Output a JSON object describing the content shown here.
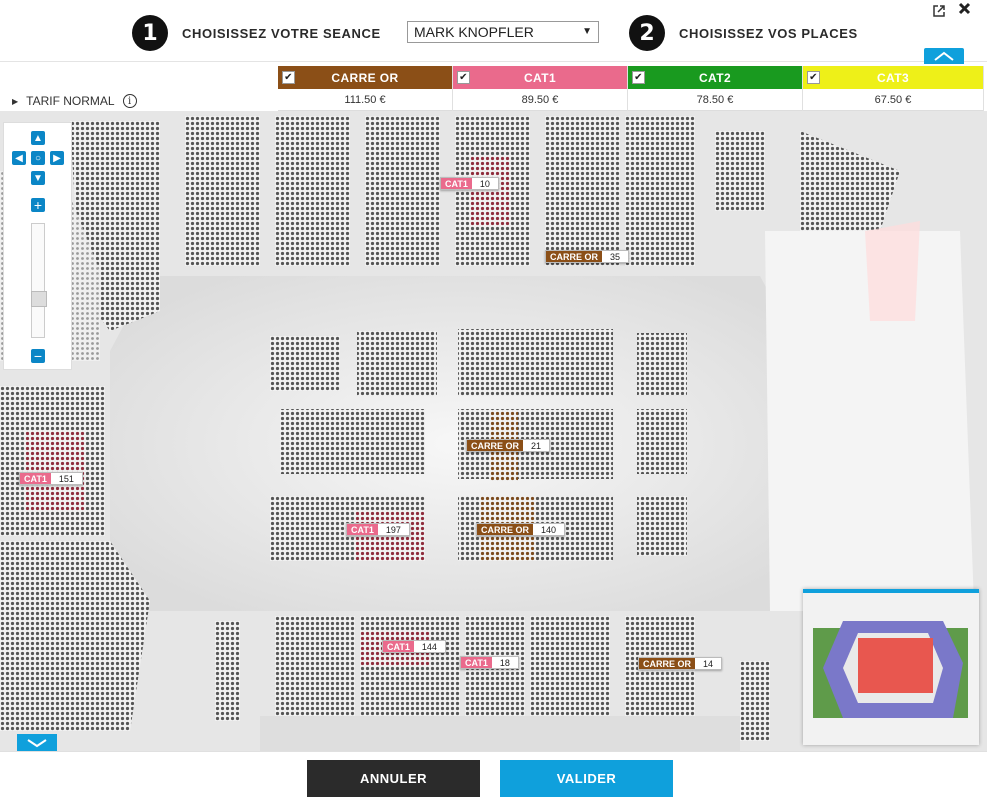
{
  "header": {
    "step1_num": "1",
    "step1_label": "CHOISISSEZ VOTRE SEANCE",
    "show_select": "MARK KNOPFLER",
    "step2_num": "2",
    "step2_label": "CHOISISSEZ VOS PLACES",
    "popout_icon": "external-link-icon",
    "close_icon": "close-icon"
  },
  "tariff": {
    "row_label": "TARIF NORMAL",
    "info_icon": "i",
    "categories": [
      {
        "name": "CARRE OR",
        "price": "111.50 €",
        "color": "#8b4f17"
      },
      {
        "name": "CAT1",
        "price": "89.50 €",
        "color": "#ea6a8c"
      },
      {
        "name": "CAT2",
        "price": "78.50 €",
        "color": "#199a1f"
      },
      {
        "name": "CAT3",
        "price": "67.50 €",
        "color": "#eef018"
      }
    ]
  },
  "map_tags": [
    {
      "cat": "CAT1",
      "count": "10"
    },
    {
      "cat": "CARRE OR",
      "count": "35"
    },
    {
      "cat": "CAT1",
      "count": "151"
    },
    {
      "cat": "CARRE OR",
      "count": "21"
    },
    {
      "cat": "CAT1",
      "count": "197"
    },
    {
      "cat": "CARRE OR",
      "count": "140"
    },
    {
      "cat": "CAT1",
      "count": "144"
    },
    {
      "cat": "CAT1",
      "count": "18"
    },
    {
      "cat": "CARRE OR",
      "count": "14"
    }
  ],
  "actions": {
    "cancel": "ANNULER",
    "validate": "VALIDER"
  }
}
